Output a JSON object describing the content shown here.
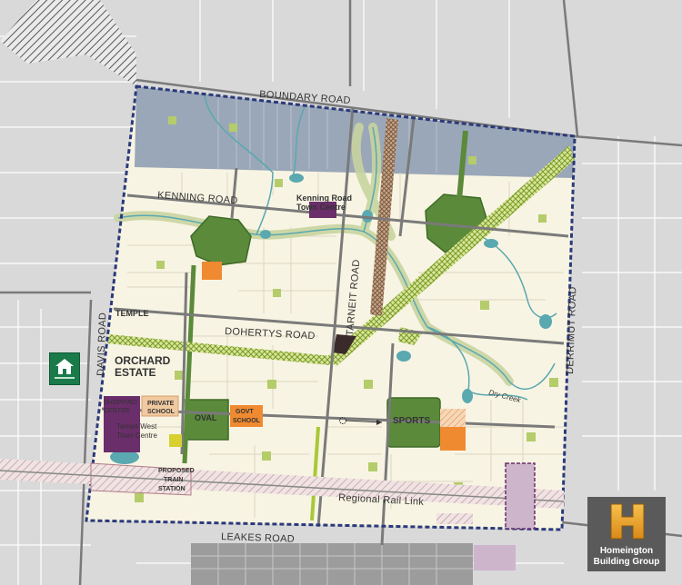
{
  "map": {
    "roads": {
      "boundary": "BOUNDARY ROAD",
      "kenning": "KENNING ROAD",
      "temple": "TEMPLE",
      "dohertys": "DOHERTYS ROAD",
      "tarneit": "TARNEIT ROAD",
      "derrimut": "DERRIMUT ROAD",
      "davis": "DAVIS ROAD",
      "leakes": "LEAKES ROAD",
      "rail": "Regional Rail Link",
      "creek": "Dry Creek"
    },
    "places": {
      "kenning_town_centre_1": "Kenning Road",
      "kenning_town_centre_2": "Town Centre",
      "orchard_1": "ORCHARD",
      "orchard_2": "ESTATE",
      "shopping_1": "SHOPPING",
      "shopping_2": "CENTRE",
      "private_school_1": "PRIVATE",
      "private_school_2": "SCHOOL",
      "oval": "OVAL",
      "govt_school_1": "GOVT",
      "govt_school_2": "SCHOOL",
      "sports": "SPORTS",
      "tarneit_west_1": "Tarneit West",
      "tarneit_west_2": "Town Centre",
      "train_1": "PROPOSED",
      "train_2": "TRAIN",
      "train_3": "STATION"
    },
    "colors": {
      "background": "#d9d9d9",
      "parcel_line": "#ffffff",
      "precinct_fill": "#f8f4e3",
      "boundary_dash": "#2b3a7a",
      "north_strip": "#9aa7b8",
      "park": "#5a8a3a",
      "small_park": "#b5cc6a",
      "creek": "#5aa8b0",
      "corridor": "#c8d4a0",
      "town_centre": "#6a2e6a",
      "school": "#f08a30",
      "private_school": "#f0c9a0",
      "rail_hatch": "#c8a0a8",
      "brown_hatch": "#8a6a50",
      "hatch_green": "#a8c838"
    }
  },
  "logo": {
    "icon": "h-letter-icon",
    "line1": "Homeington",
    "line2": "Building Group"
  },
  "badge": {
    "icon": "house-badge-icon"
  }
}
